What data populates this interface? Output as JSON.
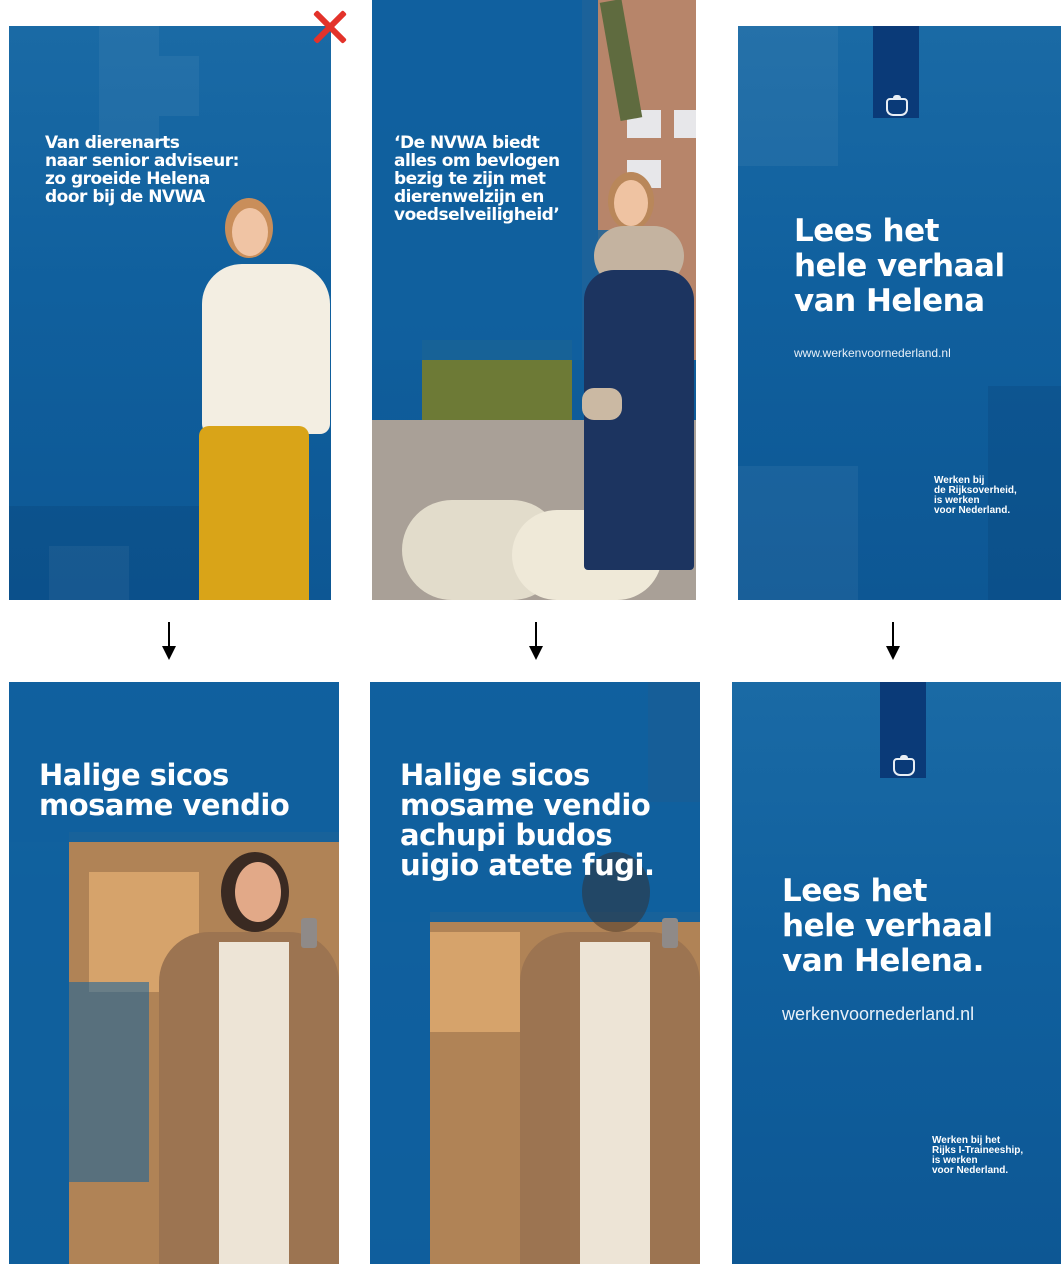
{
  "panels": {
    "p1": {
      "headline": [
        "Van dierenarts",
        "naar senior adviseur:",
        "zo groeide Helena",
        "door bij de NVWA"
      ]
    },
    "p2": {
      "headline": [
        "‘De NVWA biedt",
        "alles om bevlogen",
        "bezig te zijn met",
        "dierenwelzijn en",
        "voedselveiligheid’"
      ]
    },
    "p3": {
      "headline": [
        "Lees het",
        "hele verhaal",
        "van Helena"
      ],
      "url": "www.werkenvoornederland.nl",
      "tagline": [
        "Werken bij",
        "de Rijksoverheid,",
        "is werken",
        "voor Nederland."
      ]
    },
    "p4": {
      "headline": [
        "Halige sicos",
        "mosame vendio"
      ]
    },
    "p5": {
      "headline": [
        "Halige sicos",
        "mosame vendio",
        "achupi budos",
        "uigio atete fugi."
      ]
    },
    "p6": {
      "headline": [
        "Lees het",
        "hele verhaal",
        "van Helena."
      ],
      "url": "werkenvoornederland.nl",
      "tagline": [
        "Werken bij het",
        "Rijks I-Traineeship,",
        "is werken",
        "voor Nederland."
      ]
    }
  },
  "colors": {
    "brand_blue": "#10609e",
    "reject_red": "#e3322a",
    "rijks_band": "#0a3a78"
  },
  "icons": {
    "reject": "x-mark-icon",
    "flow": "arrow-down-icon",
    "logo": "rijks-crest-icon"
  }
}
